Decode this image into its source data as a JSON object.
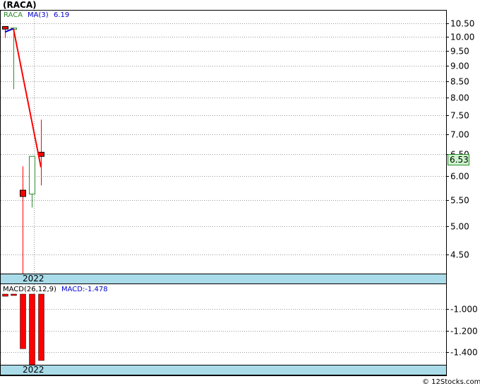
{
  "chart_data": [
    {
      "type": "candlestick",
      "title": "(RACA)",
      "symbol_label": "RACA",
      "ma_label": "MA(3)",
      "ma_value": "6.19",
      "x_label": "2022",
      "ylim": [
        4.2,
        11.0
      ],
      "y_ticks": [
        "10.50",
        "10.00",
        "9.50",
        "9.00",
        "8.50",
        "8.00",
        "7.50",
        "7.00",
        "6.50",
        "6.00",
        "5.50",
        "5.00",
        "4.50"
      ],
      "last_price": "6.53",
      "scale": "log",
      "grid": true,
      "candles": [
        {
          "open": 10.38,
          "high": 10.38,
          "low": 9.95,
          "close": 10.28
        },
        {
          "open": 10.32,
          "high": 10.32,
          "low": 8.25,
          "close": 10.32
        },
        {
          "open": 5.7,
          "high": 6.22,
          "low": 4.2,
          "close": 5.57
        },
        {
          "open": 5.62,
          "high": 6.45,
          "low": 5.35,
          "close": 6.45
        },
        {
          "open": 6.55,
          "high": 7.38,
          "low": 5.8,
          "close": 6.45
        }
      ],
      "ma": [
        10.17,
        10.3,
        6.2
      ],
      "colors": {
        "up": "#2e8b2e",
        "down": "#ff0000",
        "ma": "#ff0000",
        "ma_start": "#0000cc"
      }
    },
    {
      "type": "bar",
      "title": "MACD(26,12,9)",
      "macd_label": "MACD:-1.478",
      "x_label": "2022",
      "ylim": [
        -1.52,
        -0.84
      ],
      "y_ticks": [
        "-1.000",
        "-1.200",
        "-1.400"
      ],
      "values": [
        -0.88,
        -0.85,
        -1.37,
        -1.52,
        -1.48
      ],
      "grid": true,
      "colors": {
        "bar": "#ff0000"
      }
    }
  ],
  "footer": {
    "copyright": "© 12Stocks.com"
  }
}
